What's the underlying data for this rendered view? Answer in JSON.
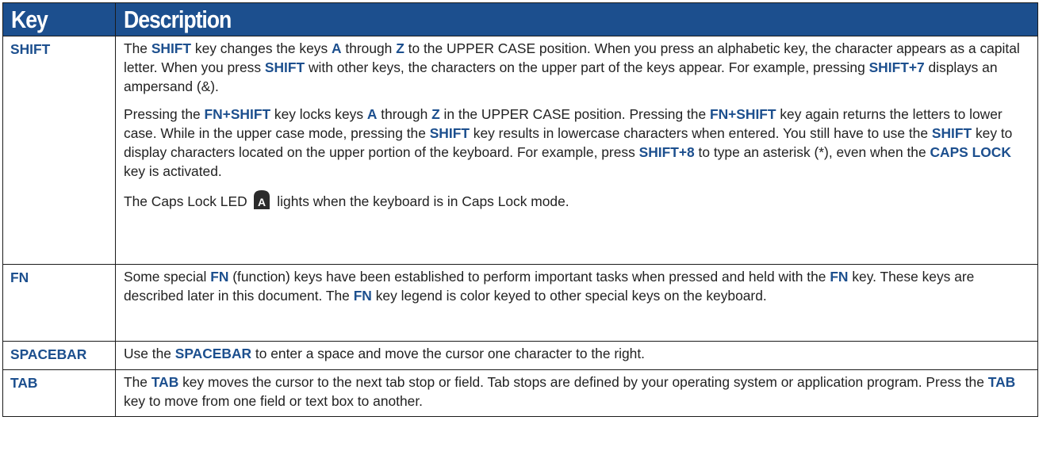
{
  "table": {
    "headers": {
      "key": "Key",
      "description": "Description"
    },
    "rows": [
      {
        "key": "SHIFT",
        "paragraphs": [
          [
            {
              "t": "The "
            },
            {
              "b": "SHIFT"
            },
            {
              "t": " key changes the keys "
            },
            {
              "b": "A"
            },
            {
              "t": " through "
            },
            {
              "b": "Z"
            },
            {
              "t": " to the UPPER CASE position. When you press an alpha­betic key, the character appears as a capital letter. When you press "
            },
            {
              "b": "SHIFT"
            },
            {
              "t": " with other keys, the charac­ters on the upper part of the keys appear. For example, pressing "
            },
            {
              "b": "SHIFT+7"
            },
            {
              "t": " displays an ampersand (&)."
            }
          ],
          [
            {
              "t": "Pressing the "
            },
            {
              "b": "FN+SHIFT"
            },
            {
              "t": " key locks keys "
            },
            {
              "b": "A"
            },
            {
              "t": " through "
            },
            {
              "b": "Z"
            },
            {
              "t": " in the UPPER CASE position. Pressing the "
            },
            {
              "b": "FN+SHIFT"
            },
            {
              "t": " key again returns the letters to lower case. While in the upper case mode, pressing the "
            },
            {
              "b": "SHIFT"
            },
            {
              "t": " key results in lowercase characters when entered. You still have to use the "
            },
            {
              "b": "SHIFT"
            },
            {
              "t": " key to dis­play characters located on the upper portion of the keyboard. For example, press "
            },
            {
              "b": "SHIFT+8"
            },
            {
              "t": " to type an asterisk (*), even when the "
            },
            {
              "b": "CAPS LOCK"
            },
            {
              "t": " key is activated."
            }
          ],
          [
            {
              "t": "The Caps Lock LED "
            },
            {
              "icon": "caps-lock-led-icon"
            },
            {
              "t": " lights when the keyboard is in Caps Lock mode."
            }
          ]
        ]
      },
      {
        "key": "FN",
        "paragraphs": [
          [
            {
              "t": "Some special "
            },
            {
              "b": "FN"
            },
            {
              "t": " (function) keys have been established to perform important tasks when pressed and held with the "
            },
            {
              "b": "FN"
            },
            {
              "t": " key. These keys are described later in this document.  The "
            },
            {
              "b": "FN"
            },
            {
              "t": " key legend is color keyed to other special keys on the keyboard."
            }
          ]
        ]
      },
      {
        "key": "SPACEBAR",
        "paragraphs": [
          [
            {
              "t": "Use the "
            },
            {
              "b": "SPACEBAR"
            },
            {
              "t": " to enter a space and move the cursor one character to the right."
            }
          ]
        ]
      },
      {
        "key": "TAB",
        "paragraphs": [
          [
            {
              "t": "The "
            },
            {
              "b": "TAB"
            },
            {
              "t": " key moves the cursor to the next tab stop or field. Tab stops are defined by your operating system or application program. Press the "
            },
            {
              "b": "TAB"
            },
            {
              "t": " key to move from one field or text box to another."
            }
          ]
        ]
      }
    ]
  },
  "colors": {
    "header_bg": "#1c4f8e",
    "keyword": "#1c4f8e",
    "body_text": "#222222"
  }
}
